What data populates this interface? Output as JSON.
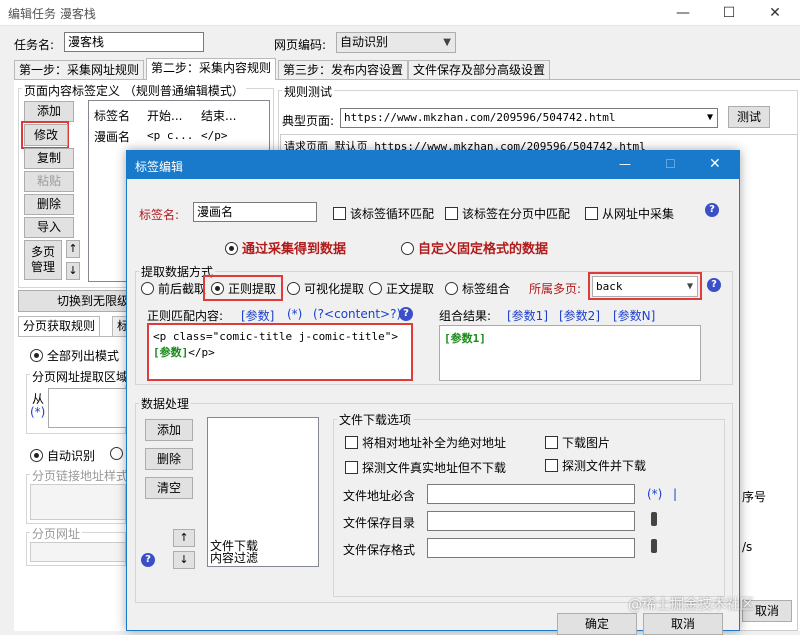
{
  "window": {
    "title": "编辑任务 漫客栈",
    "minimize": "—",
    "maximize": "☐",
    "close": "✕"
  },
  "task": {
    "name_label": "任务名:",
    "name_value": "漫客栈",
    "encoding_label": "网页编码:",
    "encoding_value": "自动识别"
  },
  "tabs": [
    "第一步：采集网址规则",
    "第二步：采集内容规则",
    "第三步：发布内容设置",
    "文件保存及部分高级设置"
  ],
  "left_panel": {
    "group_title": "页面内容标签定义 （规则普通编辑模式）",
    "buttons": [
      "添加",
      "修改",
      "复制",
      "粘贴",
      "删除",
      "导入"
    ],
    "multipage_btn": "多页\n管理",
    "up_arrow": "↑",
    "down_arrow": "↓",
    "columns": [
      "标签名",
      "开始...",
      "结束..."
    ],
    "rows": [
      [
        "漫画名",
        "<p c...",
        "</p>"
      ]
    ],
    "switch_btn": "切换到无限级",
    "subtabs": [
      "分页获取规则",
      "标"
    ],
    "list_mode": "全部列出模式",
    "pager_group": "分页网址提取区域",
    "from_label": "从",
    "star": "(*)",
    "auto_identify": "自动识别",
    "link_style": "分页链接地址样式",
    "page_url": "分页网址"
  },
  "right_panel": {
    "group_title": "规则测试",
    "typical_label": "典型页面:",
    "typical_url": "https://www.mkzhan.com/209596/504742.html",
    "test_btn": "测试",
    "request_line": "请求页面 默认页 https://www.mkzhan.com/209596/504742.html"
  },
  "behind_partials": {
    "seq": "序号",
    "s": "/s",
    "cancel": "取消"
  },
  "dialog": {
    "title": "标签编辑",
    "min": "—",
    "max": "☐",
    "close": "✕",
    "tag_name_label": "标签名:",
    "tag_name_value": "漫画名",
    "loop_match": "该标签循环匹配",
    "page_match": "该标签在分页中匹配",
    "from_url": "从网址中采集",
    "help": "?",
    "source_collect": "通过采集得到数据",
    "source_fixed": "自定义固定格式的数据",
    "extract_group": "提取数据方式",
    "modes": [
      "前后截取",
      "正则提取",
      "可视化提取",
      "正文提取",
      "标签组合"
    ],
    "multipage_label": "所属多页:",
    "multipage_value": "back",
    "regex_label": "正则匹配内容:",
    "regex_links": [
      "[参数]",
      "(*)",
      "(?<content>?)"
    ],
    "regex_code": "<p class=\"comic-title j-comic-title\">",
    "regex_param": "[参数]",
    "regex_tail": "</p>",
    "combo_label": "组合结果:",
    "combo_links": [
      "[参数1]",
      "[参数2]",
      "[参数N]"
    ],
    "combo_value": "[参数1]",
    "process_group": "数据处理",
    "process_btns": [
      "添加",
      "删除",
      "清空"
    ],
    "process_items": [
      "文件下载",
      "内容过滤"
    ],
    "up": "↑",
    "down": "↓",
    "file_group": "文件下载选项",
    "file_opts": [
      "将相对地址补全为绝对地址",
      "下载图片",
      "探测文件真实地址但不下载",
      "探测文件并下载"
    ],
    "file_labels": [
      "文件地址必含",
      "文件保存目录",
      "文件保存格式"
    ],
    "file_star": "(*)",
    "file_bar": "|",
    "ok": "确定",
    "cancel": "取消"
  },
  "watermark": "@稀土掘金技术社区"
}
